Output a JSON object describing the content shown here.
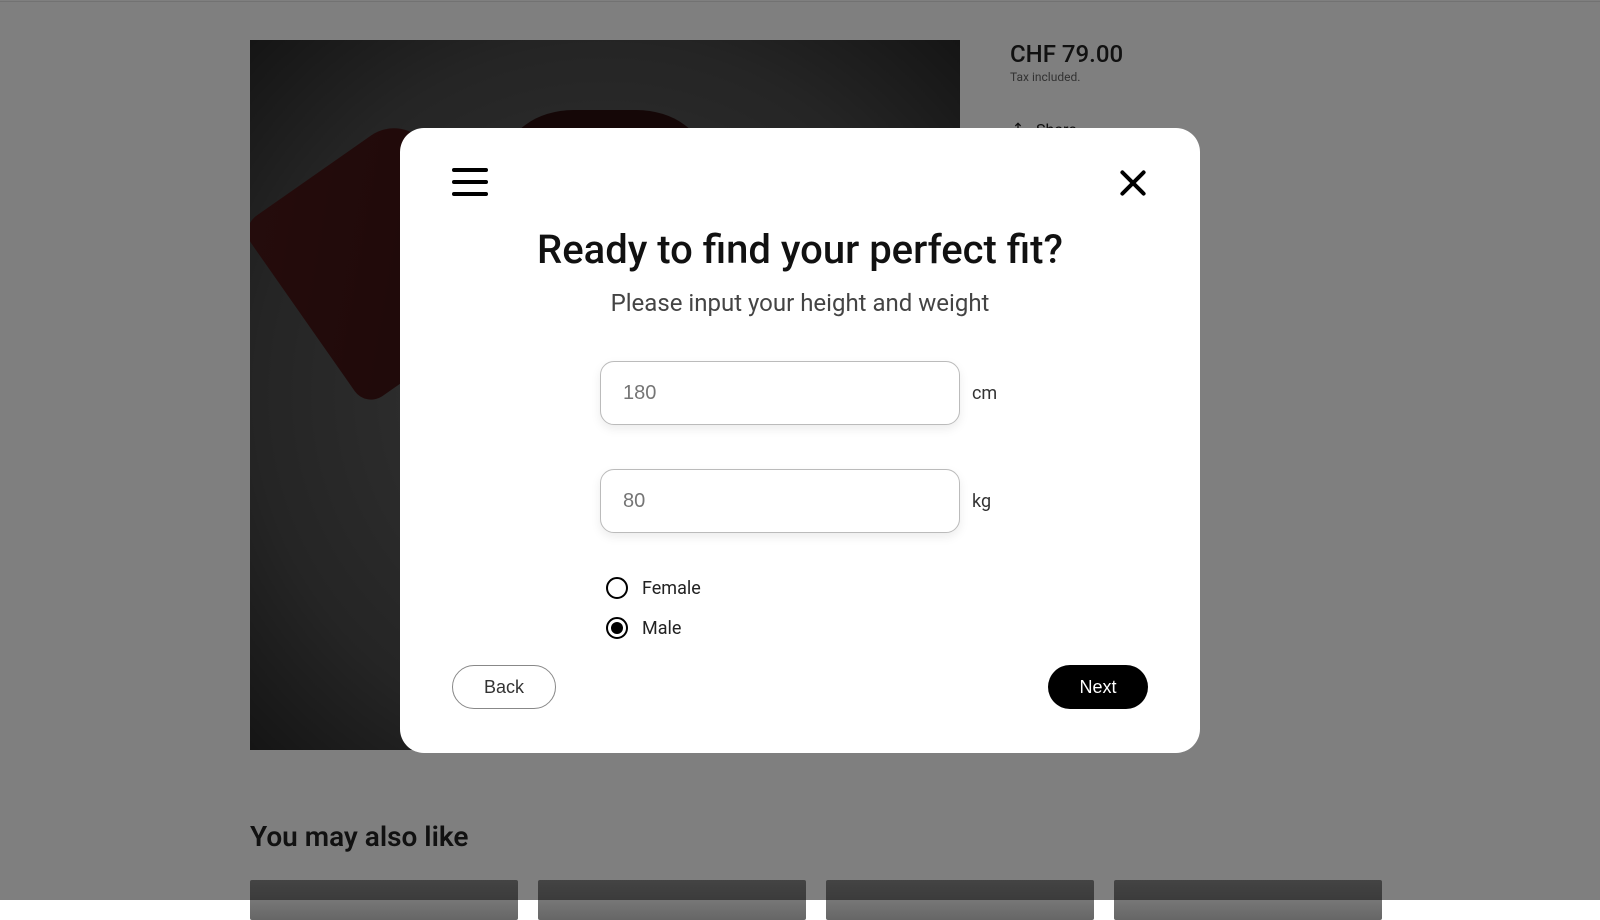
{
  "product": {
    "price": "CHF 79.00",
    "tax_note": "Tax included.",
    "share_label": "Share"
  },
  "related": {
    "heading": "You may also like"
  },
  "modal": {
    "title": "Ready to find your perfect fit?",
    "subtitle": "Please input your height and weight",
    "height": {
      "placeholder": "180",
      "unit": "cm"
    },
    "weight": {
      "placeholder": "80",
      "unit": "kg"
    },
    "gender": {
      "female_label": "Female",
      "male_label": "Male",
      "selected": "male"
    },
    "back_label": "Back",
    "next_label": "Next"
  }
}
